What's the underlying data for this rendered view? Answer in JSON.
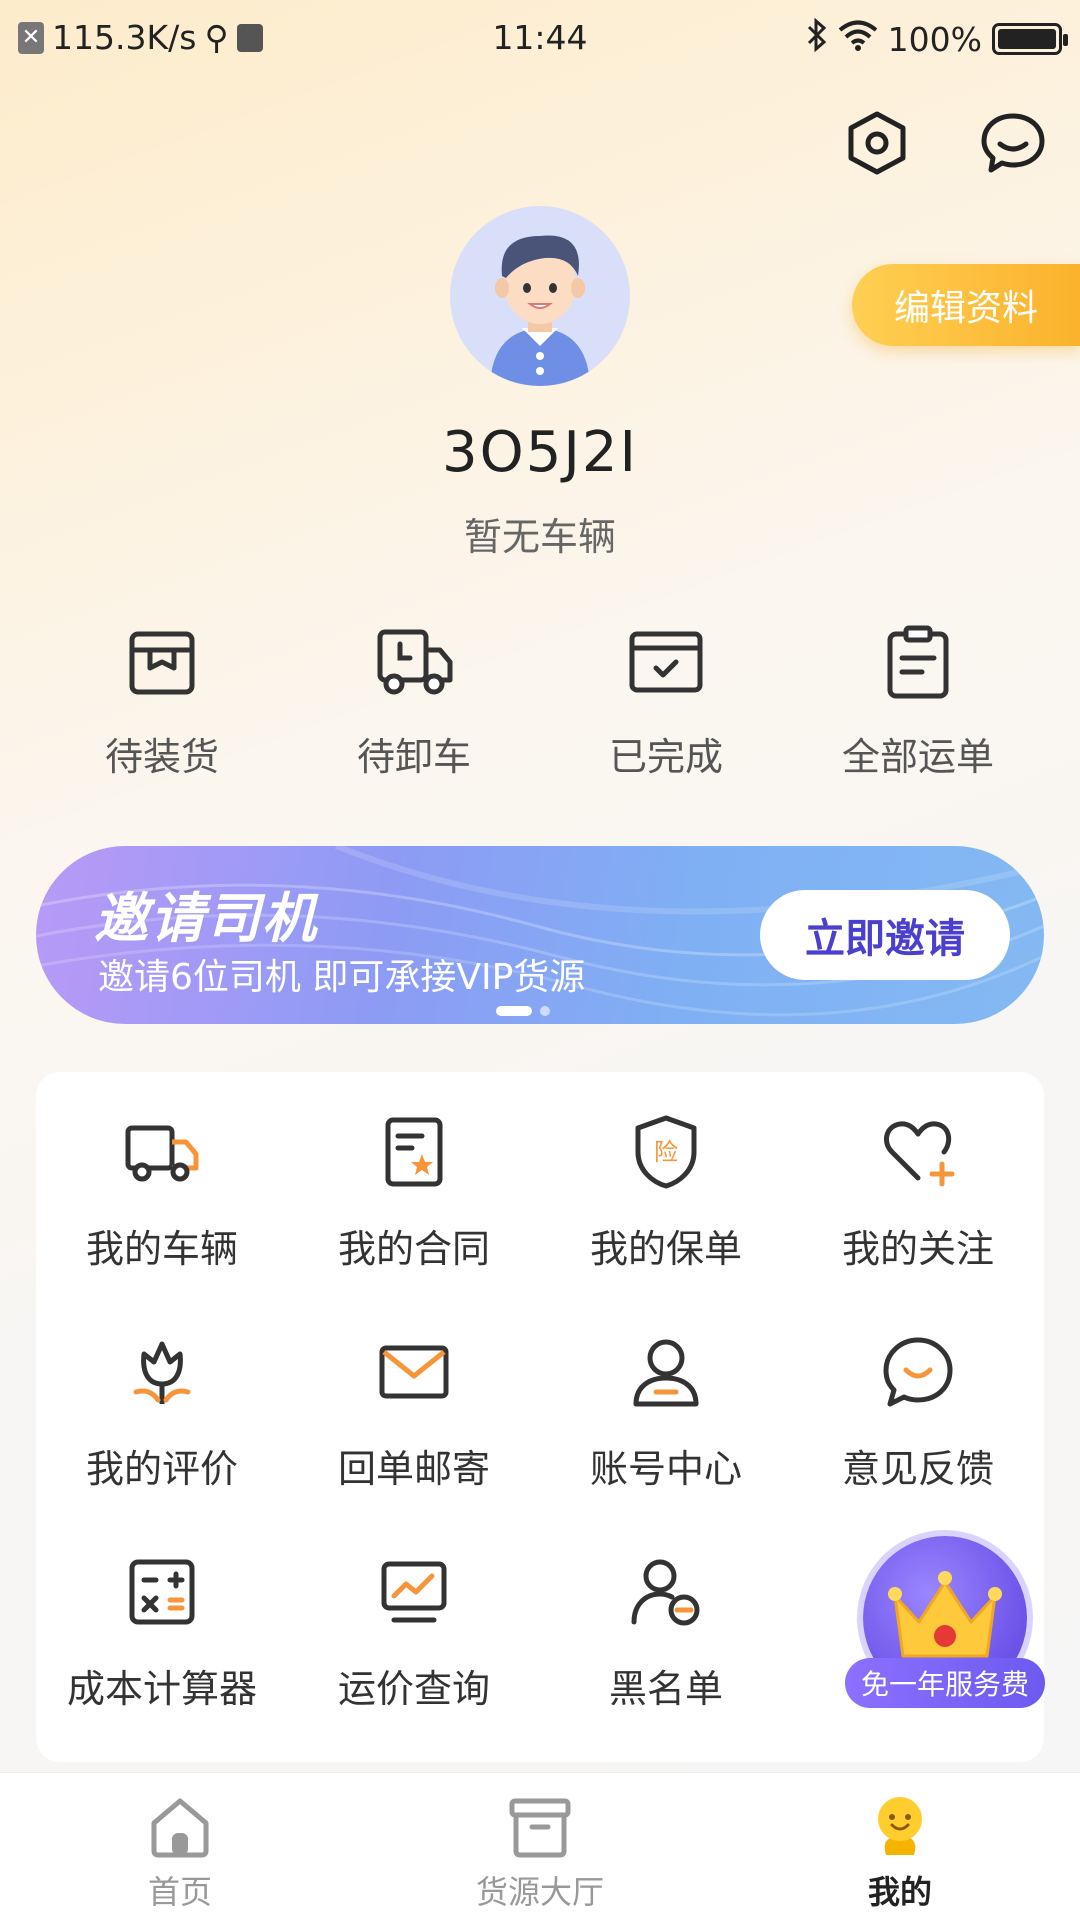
{
  "status_bar": {
    "net_speed": "115.3K/s",
    "time": "11:44",
    "battery": "100%",
    "battery_level": 1.0
  },
  "header": {
    "settings_icon": "settings-hexagon-icon",
    "message_icon": "chat-bubble-icon",
    "edit_profile": "编辑资料"
  },
  "profile": {
    "username": "3O5J2I",
    "vehicle_status": "暂无车辆"
  },
  "orders": [
    {
      "label": "待装货",
      "icon": "package-box-icon"
    },
    {
      "label": "待卸车",
      "icon": "delivery-truck-icon"
    },
    {
      "label": "已完成",
      "icon": "completed-card-icon"
    },
    {
      "label": "全部运单",
      "icon": "clipboard-icon"
    }
  ],
  "banner": {
    "title": "邀请司机",
    "subtitle": "邀请6位司机 即可承接VIP货源",
    "button": "立即邀请",
    "page_count": 2,
    "active_page": 1
  },
  "services": [
    {
      "label": "我的车辆",
      "icon": "truck-icon"
    },
    {
      "label": "我的合同",
      "icon": "contract-icon"
    },
    {
      "label": "我的保单",
      "icon": "insurance-shield-icon",
      "badge": "险"
    },
    {
      "label": "我的关注",
      "icon": "heart-plus-icon"
    },
    {
      "label": "我的评价",
      "icon": "flower-icon"
    },
    {
      "label": "回单邮寄",
      "icon": "mail-icon"
    },
    {
      "label": "账号中心",
      "icon": "user-icon"
    },
    {
      "label": "意见反馈",
      "icon": "feedback-smile-icon"
    },
    {
      "label": "成本计算器",
      "icon": "calculator-icon"
    },
    {
      "label": "运价查询",
      "icon": "price-chart-icon"
    },
    {
      "label": "黑名单",
      "icon": "user-block-icon"
    }
  ],
  "promo": {
    "label": "免一年服务费",
    "icon": "crown-icon"
  },
  "tabbar": [
    {
      "label": "首页",
      "icon": "home-icon",
      "active": false
    },
    {
      "label": "货源大厅",
      "icon": "cargo-box-icon",
      "active": false
    },
    {
      "label": "我的",
      "icon": "smiley-face-icon",
      "active": true
    }
  ],
  "colors": {
    "accent_orange": "#f7953b",
    "edit_button": "#fbb22c",
    "invite_button_text": "#4b3fd0",
    "icon_dark": "#333333"
  }
}
